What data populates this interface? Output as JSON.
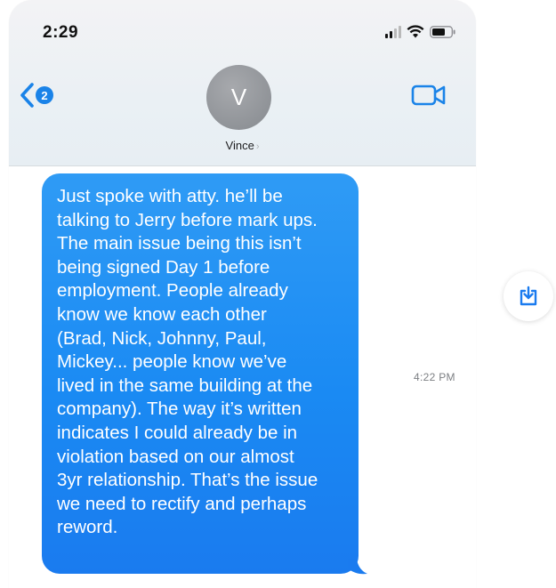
{
  "status_bar": {
    "time": "2:29"
  },
  "header": {
    "back_badge_count": "2",
    "avatar_initial": "V",
    "contact_name": "Vince",
    "contact_chevron": "›"
  },
  "message": {
    "text": "Just spoke with atty. he’ll be\ntalking to Jerry before mark ups.\nThe main issue being this isn’t\nbeing signed Day 1 before\nemployment. People already\nknow we know each other\n(Brad, Nick, Johnny, Paul,\nMickey... people know we’ve\nlived in the same building at the\ncompany). The way it’s written\nindicates I could already be in\nviolation based on our almost\n3yr relationship. That’s the issue\nwe need to rectify and perhaps\nreword.",
    "timestamp": "4:22 PM"
  },
  "colors": {
    "accent": "#1a83e8",
    "bubble": "#1a8af3",
    "header_bg": "#eaf0f4"
  },
  "icons": {
    "back": "chevron-left-icon",
    "video": "video-camera-icon",
    "download": "download-icon",
    "signal": "cellular-signal-icon",
    "wifi": "wifi-icon",
    "battery": "battery-icon"
  }
}
